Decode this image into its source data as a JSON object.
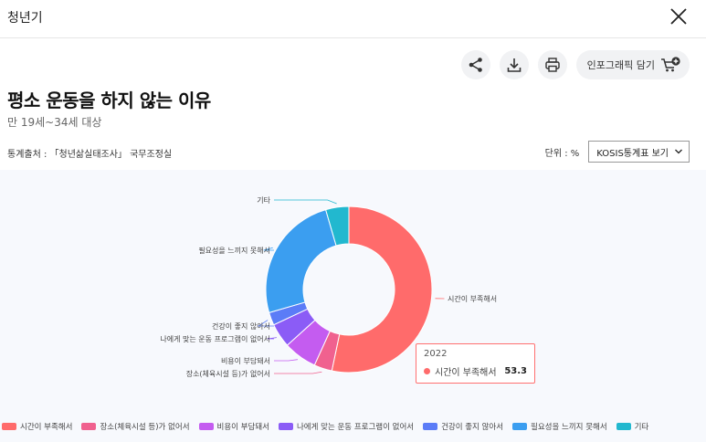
{
  "header": {
    "title": "청년기"
  },
  "actions": {
    "infographic_label": "인포그래픽 담기"
  },
  "page": {
    "title": "평소 운동을 하지 않는 이유",
    "subtitle": "만 19세~34세 대상",
    "source": "통계출처 : 「청년삶실태조사」 국무조정실",
    "unit": "단위 : %",
    "kosis_select": "KOSIS통계표 보기"
  },
  "tooltip": {
    "year": "2022",
    "label": "시간이 부족해서",
    "value": "53.3",
    "color": "#ff6b6b"
  },
  "chart_data": {
    "type": "pie",
    "donut": true,
    "year": "2022",
    "categories": [
      "시간이 부족해서",
      "장소(체육시설 등)가 없어서",
      "비용이 부담돼서",
      "나에게 맞는 운동 프로그램이 없어서",
      "건강이 좋지 않아서",
      "필요성을 느끼지 못해서",
      "기타"
    ],
    "values": [
      53.3,
      3.5,
      6.5,
      4.7,
      2.5,
      25.0,
      4.5
    ],
    "colors": [
      "#ff6b6b",
      "#f0618f",
      "#c45cf0",
      "#8b5cf6",
      "#5b7cf7",
      "#3b9ef0",
      "#22b8cf"
    ],
    "legend_position": "bottom"
  }
}
